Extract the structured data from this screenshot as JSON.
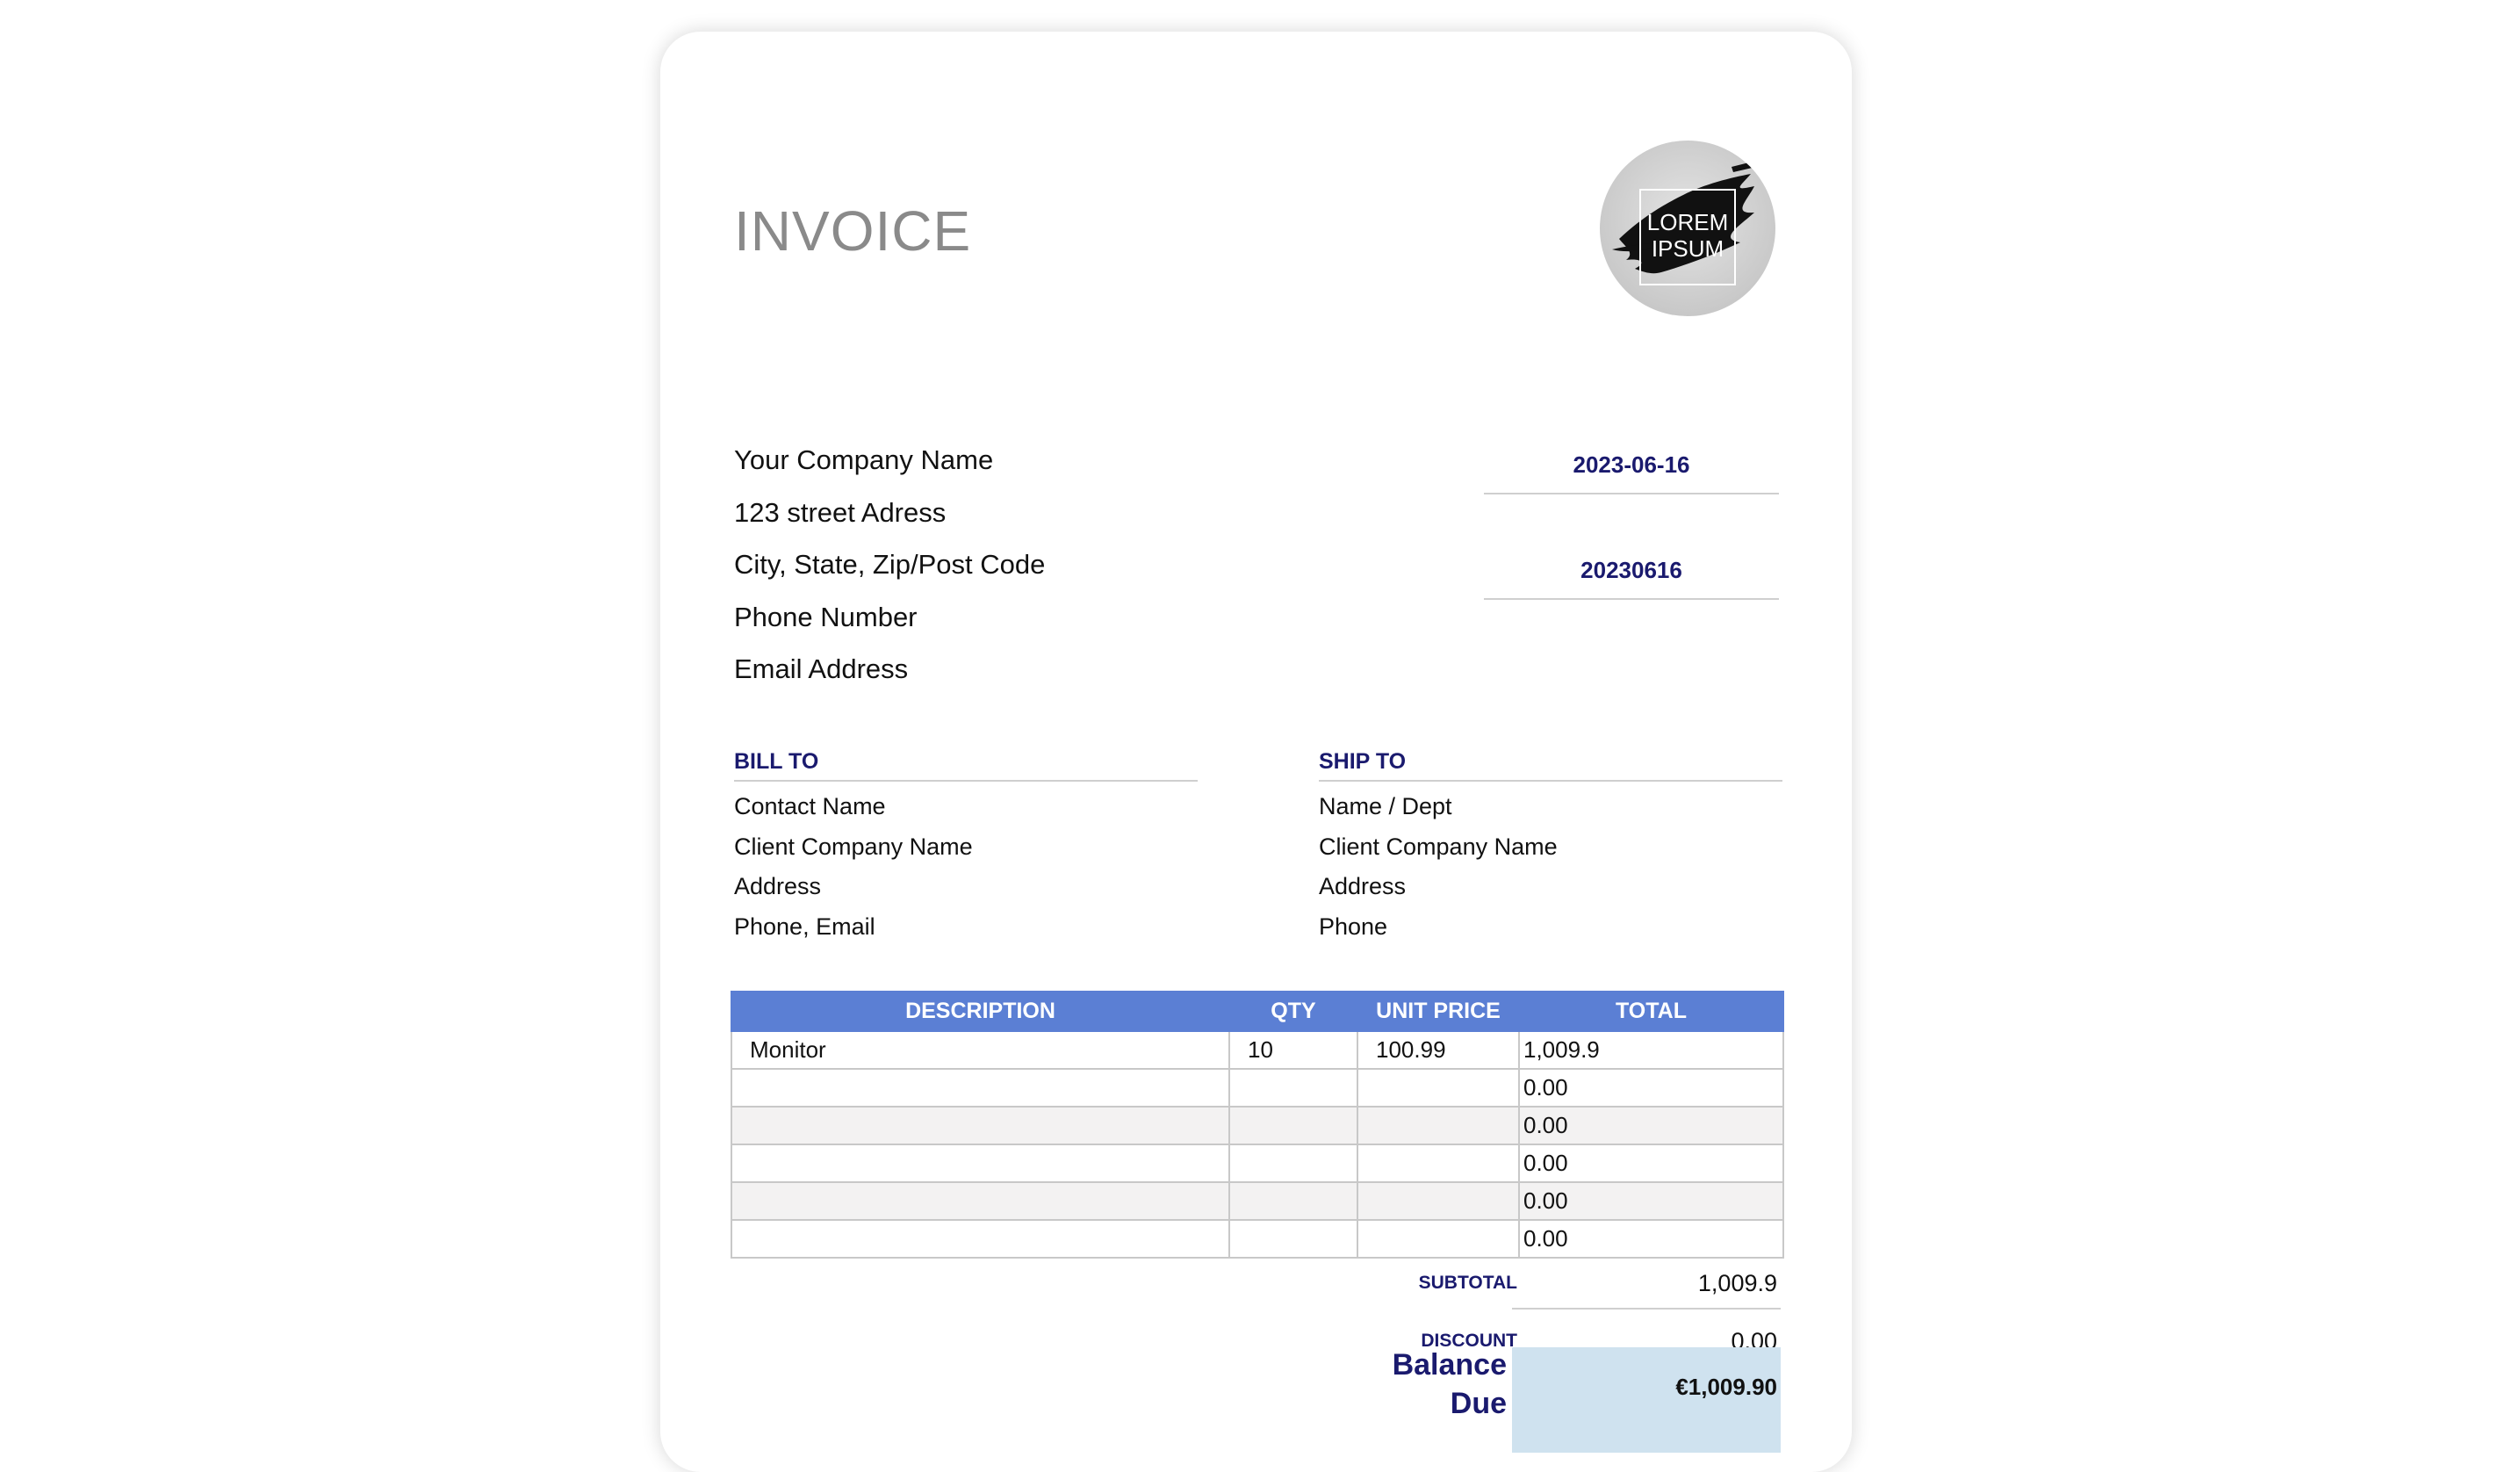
{
  "header": {
    "title": "INVOICE",
    "logo_text_line1": "LOREM",
    "logo_text_line2": "IPSUM"
  },
  "company": {
    "name": "Your Company Name",
    "street": "123 street Adress",
    "city": "City, State, Zip/Post Code",
    "phone": "Phone Number",
    "email": "Email Address"
  },
  "meta": {
    "date": "2023-06-16",
    "invoice_number": "20230616"
  },
  "bill_to": {
    "heading": "BILL TO",
    "lines": [
      "Contact Name",
      "Client Company Name",
      "Address",
      "Phone, Email"
    ]
  },
  "ship_to": {
    "heading": "SHIP TO",
    "lines": [
      "Name / Dept",
      "Client Company Name",
      "Address",
      "Phone"
    ]
  },
  "items": {
    "columns": [
      "DESCRIPTION",
      "QTY",
      "UNIT PRICE",
      "TOTAL"
    ],
    "rows": [
      {
        "description": "Monitor",
        "qty": "10",
        "unit_price": "100.99",
        "total": "1,009.9"
      },
      {
        "description": "",
        "qty": "",
        "unit_price": "",
        "total": "0.00"
      },
      {
        "description": "",
        "qty": "",
        "unit_price": "",
        "total": "0.00"
      },
      {
        "description": "",
        "qty": "",
        "unit_price": "",
        "total": "0.00"
      },
      {
        "description": "",
        "qty": "",
        "unit_price": "",
        "total": "0.00"
      },
      {
        "description": "",
        "qty": "",
        "unit_price": "",
        "total": "0.00"
      }
    ]
  },
  "summary": {
    "subtotal_label": "SUBTOTAL",
    "subtotal_value": "1,009.9",
    "discount_label": "DISCOUNT",
    "discount_value": "0.00",
    "balance_label_line1": "Balance",
    "balance_label_line2": "Due",
    "balance_value": "€1,009.90"
  },
  "colors": {
    "accent_header": "#5b7fd4",
    "label_navy": "#1a1a6e",
    "balance_bg": "#cfe2ef"
  }
}
